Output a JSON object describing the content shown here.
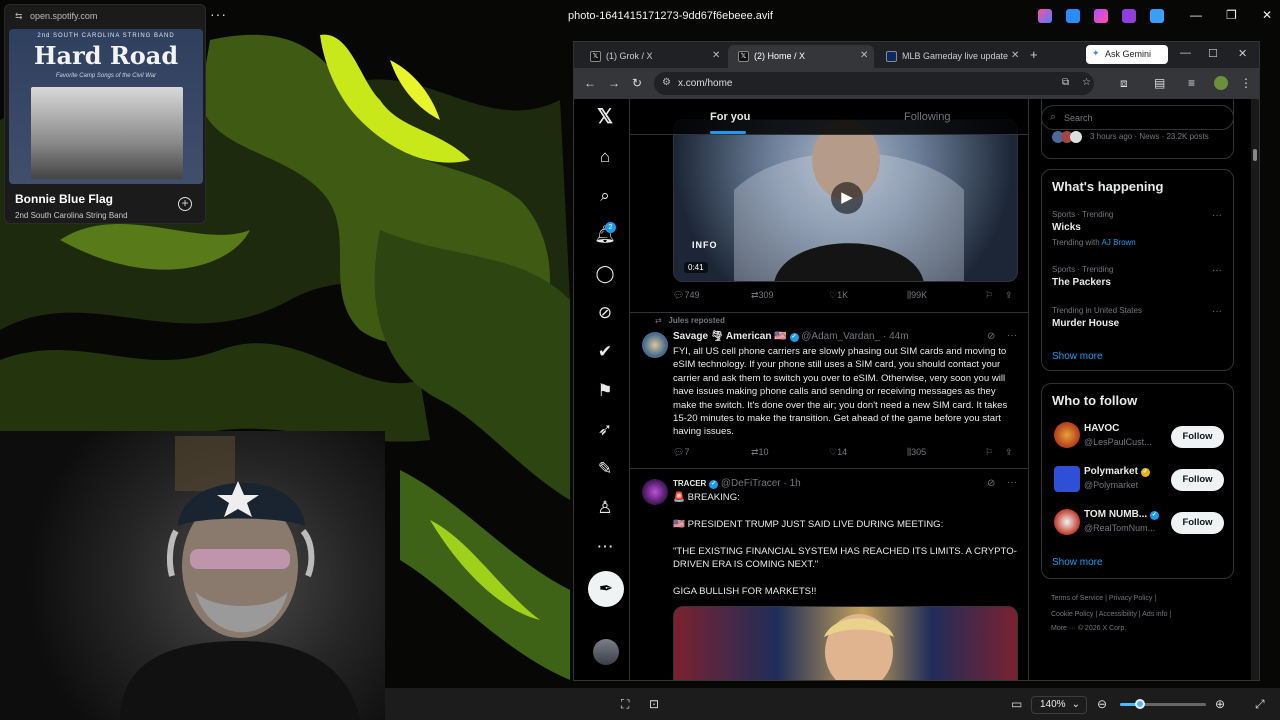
{
  "viewer": {
    "filename": "photo-1641415171273-9dd67f6ebeee.avif",
    "zoom": "140%",
    "zoom_slider_fraction": 0.23
  },
  "spotify": {
    "url": "open.spotify.com",
    "album_band": "2nd SOUTH CAROLINA STRING BAND",
    "album_title": "Hard Road",
    "album_subtitle": "Favorite Camp Songs of the Civil War",
    "song": "Bonnie Blue Flag",
    "artist": "2nd South Carolina String Band"
  },
  "browser": {
    "tabs": [
      {
        "label": "(1) Grok / X",
        "active": false
      },
      {
        "label": "(2) Home / X",
        "active": true
      },
      {
        "label": "MLB Gameday live updates",
        "active": false
      }
    ],
    "ask_gemini": "Ask Gemini",
    "url": "x.com/home"
  },
  "x": {
    "notification_count": "2",
    "feed_tabs": {
      "for_you": "For you",
      "following": "Following"
    },
    "video_post": {
      "duration": "0:41",
      "channel_mark": "INFO",
      "replies": "749",
      "reposts": "309",
      "likes": "1K",
      "views": "99K"
    },
    "post1": {
      "repost_label": "Jules reposted",
      "name": "Savage 🌪 American 🇺🇸",
      "handle": "@Adam_Vardan_",
      "time": "· 44m",
      "text": "FYI, all US cell phone carriers are slowly phasing out SIM cards and moving to eSIM technology. If your phone still uses a SIM card, you should contact your carrier and ask them to switch you over to eSIM. Otherwise, very soon you will have issues making phone calls and sending or receiving messages as they make the switch. It's done over the air; you don't need a new SIM card. It takes 15-20 minutes to make the transition. Get ahead of the game before you start having issues.",
      "replies": "7",
      "reposts": "10",
      "likes": "14",
      "views": "305"
    },
    "post2": {
      "name": "TRACER",
      "handle": "@DeFiTracer",
      "time": "· 1h",
      "line1": "🚨 BREAKING:",
      "line2": "🇺🇸 PRESIDENT TRUMP JUST SAID LIVE DURING MEETING:",
      "line3": "\"THE EXISTING FINANCIAL SYSTEM HAS REACHED ITS LIMITS. A CRYPTO-DRIVEN ERA IS COMING NEXT.\"",
      "line4": "GIGA BULLISH FOR MARKETS!!"
    },
    "search_placeholder": "Search",
    "top_snippet": "3 hours ago · News · 23.2K posts",
    "whats_happening": {
      "title": "What's happening",
      "trends": [
        {
          "category": "Sports · Trending",
          "name": "Wicks",
          "extra_prefix": "Trending with",
          "extra_link": "AJ Brown"
        },
        {
          "category": "Sports · Trending",
          "name": "The Packers"
        },
        {
          "category": "Trending in United States",
          "name": "Murder House"
        }
      ],
      "show_more": "Show more"
    },
    "who_to_follow": {
      "title": "Who to follow",
      "accounts": [
        {
          "name": "HAVOC",
          "handle": "@LesPaulCust...",
          "button": "Follow"
        },
        {
          "name": "Polymarket",
          "handle": "@Polymarket",
          "button": "Follow"
        },
        {
          "name": "TOM NUMB...",
          "handle": "@RealTomNum...",
          "button": "Follow"
        }
      ],
      "show_more": "Show more"
    },
    "footer": {
      "line1": "Terms of Service  |  Privacy Policy  |",
      "line2": "Cookie Policy  |  Accessibility  |  Ads info  |",
      "line3": "More ···   © 2026 X Corp."
    }
  }
}
